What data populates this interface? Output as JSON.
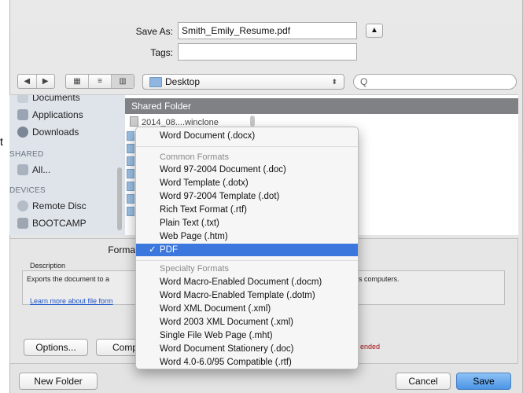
{
  "save_as": {
    "label": "Save As:",
    "value": "Smith_Emily_Resume.pdf"
  },
  "tags": {
    "label": "Tags:",
    "value": ""
  },
  "expand_button": "▲",
  "nav": {
    "back": "◀",
    "forward": "▶"
  },
  "view_modes": {
    "icon": "▦",
    "list": "≡",
    "column": "▥"
  },
  "location": {
    "value": "Desktop",
    "arrows": "⬍",
    "folder_icon": "folder-icon"
  },
  "search": {
    "placeholder": "",
    "icon": "Q"
  },
  "sidebar": {
    "top_partial": "Documents",
    "favorites": [
      {
        "label": "Applications",
        "icon": "applications-icon"
      },
      {
        "label": "Downloads",
        "icon": "downloads-icon"
      }
    ],
    "shared_header": "SHARED",
    "shared": [
      {
        "label": "All...",
        "icon": "network-icon"
      }
    ],
    "devices_header": "DEVICES",
    "devices": [
      {
        "label": "Remote Disc",
        "icon": "disc-icon"
      },
      {
        "label": "BOOTCAMP",
        "icon": "drive-icon"
      }
    ]
  },
  "browser": {
    "column_title": "Shared Folder",
    "first_file": "2014_08....winclone"
  },
  "stray_char": "t",
  "format": {
    "label": "Forma",
    "description_label": "Description",
    "description_text": "Exports the document to a",
    "description_text_right": "s computers.",
    "learn_more": "Learn more about file form",
    "compat_note": "ended"
  },
  "buttons": {
    "options": "Options...",
    "compat": "Compa",
    "new_folder": "New Folder",
    "cancel": "Cancel",
    "save": "Save"
  },
  "menu": {
    "top_item": "Word Document (.docx)",
    "common_header": "Common Formats",
    "common": [
      "Word 97-2004 Document (.doc)",
      "Word Template (.dotx)",
      "Word 97-2004 Template (.dot)",
      "Rich Text Format (.rtf)",
      "Plain Text (.txt)",
      "Web Page (.htm)"
    ],
    "selected": "PDF",
    "check": "✓",
    "specialty_header": "Specialty Formats",
    "specialty": [
      "Word Macro-Enabled Document (.docm)",
      "Word Macro-Enabled Template (.dotm)",
      "Word XML Document (.xml)",
      "Word 2003 XML Document (.xml)",
      "Single File Web Page (.mht)",
      "Word Document Stationery (.doc)",
      "Word 4.0-6.0/95 Compatible (.rtf)"
    ]
  },
  "colors": {
    "selection": "#3c77dd",
    "save_button": "#4a94e6",
    "column_header": "#7f8184"
  }
}
